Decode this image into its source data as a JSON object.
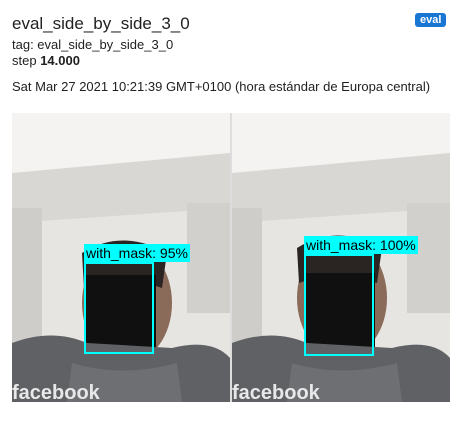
{
  "header": {
    "title": "eval_side_by_side_3_0",
    "badge": "eval",
    "tag_line": "tag: eval_side_by_side_3_0",
    "step_label": "step",
    "step_value": "14.000",
    "timestamp": "Sat Mar 27 2021 10:21:39 GMT+0100 (hora estándar de Europa central)"
  },
  "images": [
    {
      "detection_label": "with_mask: 95%"
    },
    {
      "detection_label": "with_mask: 100%"
    }
  ],
  "colors": {
    "accent": "#1976d2",
    "detection_box": "#00ffff"
  }
}
